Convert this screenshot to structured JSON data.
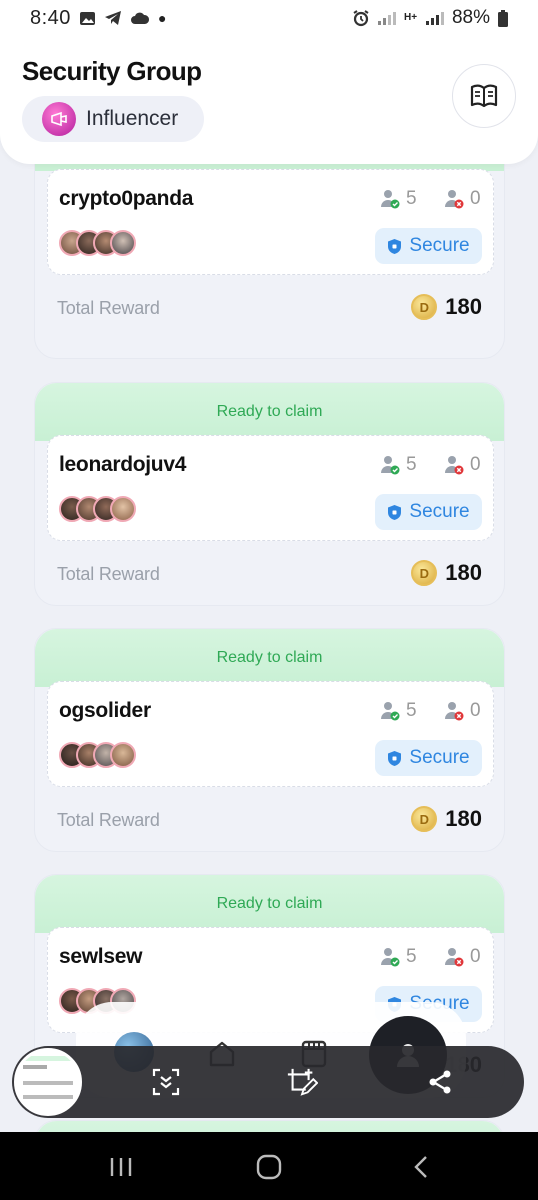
{
  "status_bar": {
    "time": "8:40",
    "battery": "88%",
    "network_label": "H+"
  },
  "header": {
    "title": "Security Group",
    "role_label": "Influencer"
  },
  "cards": [
    {
      "band": "",
      "username": "crypto0panda",
      "secure_count": "5",
      "lost_count": "0",
      "secure_label": "Secure",
      "reward_label": "Total Reward",
      "reward_value": "180"
    },
    {
      "band": "Ready to claim",
      "username": "leonardojuv4",
      "secure_count": "5",
      "lost_count": "0",
      "secure_label": "Secure",
      "reward_label": "Total Reward",
      "reward_value": "180"
    },
    {
      "band": "Ready to claim",
      "username": "ogsolider",
      "secure_count": "5",
      "lost_count": "0",
      "secure_label": "Secure",
      "reward_label": "Total Reward",
      "reward_value": "180"
    },
    {
      "band": "Ready to claim",
      "username": "sewlsew",
      "secure_count": "5",
      "lost_count": "0",
      "secure_label": "Secure",
      "reward_label": "",
      "reward_value": "180"
    }
  ],
  "colors": {
    "accent_green": "#2fa955",
    "secure_blue": "#2f86e0",
    "influencer_pink": "#d62fb6"
  },
  "icons": {
    "book": "book-icon",
    "coin": "coin-icon",
    "shield": "shield-icon",
    "user_ok": "user-check-icon",
    "user_x": "user-x-icon"
  }
}
